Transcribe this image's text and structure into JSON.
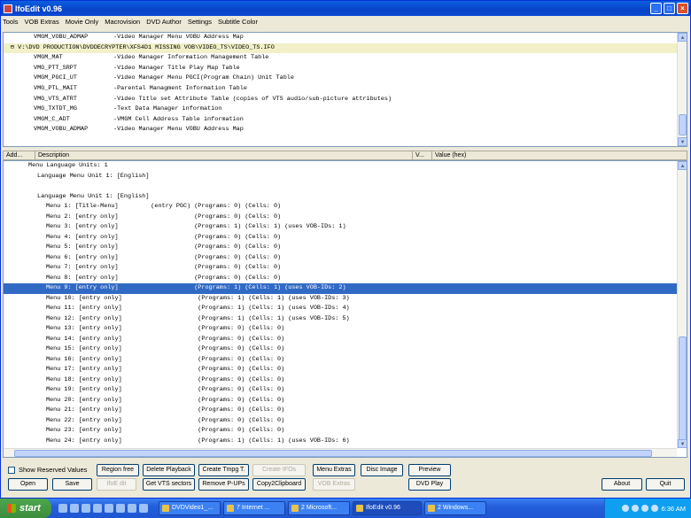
{
  "window": {
    "title": "IfoEdit v0.96",
    "min": "_",
    "max": "□",
    "close": "×"
  },
  "menu": [
    "Tools",
    "VOB Extras",
    "Movie Only",
    "Macrovision",
    "DVD Author",
    "Settings",
    "Subtitle Color"
  ],
  "tree_rows": [
    {
      "name": "VMGM_VOBU_ADMAP",
      "desc": "-Video Manager Menu VOBU Address Map",
      "indent": 1
    },
    {
      "name": "V:\\DVD PRODUCTION\\DVDDECRYPTER\\XFS4D1 MISSING VOB\\VIDEO_TS\\VIDEO_TS.IFO",
      "desc": "",
      "indent": 0,
      "root": true
    },
    {
      "name": "VMGM_MAT",
      "desc": "-Video Manager Information Management Table",
      "indent": 1
    },
    {
      "name": "VMG_PTT_SRPT",
      "desc": "-Video Manager Title Play Map Table",
      "indent": 1
    },
    {
      "name": "VMGM_PGCI_UT",
      "desc": "-Video Manager Menu PGCI(Program Chain) Unit Table",
      "indent": 1
    },
    {
      "name": "VMG_PTL_MAIT",
      "desc": "-Parental Managment Information Table",
      "indent": 1
    },
    {
      "name": "VMG_VTS_ATRT",
      "desc": "-Video Title set Attribute Table (copies of VTS audio/sub-picture attributes)",
      "indent": 1
    },
    {
      "name": "VMG_TXTDT_MG",
      "desc": "-Text Data Manager information",
      "indent": 1
    },
    {
      "name": "VMGM_C_ADT",
      "desc": "-VMGM Cell Address Table information",
      "indent": 1
    },
    {
      "name": "VMGM_VOBU_ADMAP",
      "desc": "-Video Manager Menu VOBU Address Map",
      "indent": 1
    }
  ],
  "list_headers": {
    "add": "Add...",
    "desc": "Description",
    "v": "V...",
    "value": "Value (hex)"
  },
  "list_rows": [
    {
      "text": "Menu Language Units: 1",
      "indent": 4
    },
    {
      "text": "Language Menu Unit 1: [English]",
      "indent": 6
    },
    {
      "text": "",
      "indent": 0
    },
    {
      "text": "Language Menu Unit 1: [English]",
      "indent": 6
    },
    {
      "text": "Menu 1: [Title-Menu]         (entry PGC) (Programs: 0) (Cells: 0)",
      "indent": 8
    },
    {
      "text": "Menu 2: [entry only]                     (Programs: 0) (Cells: 0)",
      "indent": 8
    },
    {
      "text": "Menu 3: [entry only]                     (Programs: 1) (Cells: 1) (uses VOB-IDs: 1)",
      "indent": 8
    },
    {
      "text": "Menu 4: [entry only]                     (Programs: 0) (Cells: 0)",
      "indent": 8
    },
    {
      "text": "Menu 5: [entry only]                     (Programs: 0) (Cells: 0)",
      "indent": 8
    },
    {
      "text": "Menu 6: [entry only]                     (Programs: 0) (Cells: 0)",
      "indent": 8
    },
    {
      "text": "Menu 7: [entry only]                     (Programs: 0) (Cells: 0)",
      "indent": 8
    },
    {
      "text": "Menu 8: [entry only]                     (Programs: 0) (Cells: 0)",
      "indent": 8
    },
    {
      "text": "Menu 9: [entry only]                     (Programs: 1) (Cells: 1) (uses VOB-IDs: 2)",
      "indent": 8,
      "selected": true
    },
    {
      "text": "Menu 10: [entry only]                     (Programs: 1) (Cells: 1) (uses VOB-IDs: 3)",
      "indent": 8
    },
    {
      "text": "Menu 11: [entry only]                     (Programs: 1) (Cells: 1) (uses VOB-IDs: 4)",
      "indent": 8
    },
    {
      "text": "Menu 12: [entry only]                     (Programs: 1) (Cells: 1) (uses VOB-IDs: 5)",
      "indent": 8
    },
    {
      "text": "Menu 13: [entry only]                     (Programs: 0) (Cells: 0)",
      "indent": 8
    },
    {
      "text": "Menu 14: [entry only]                     (Programs: 0) (Cells: 0)",
      "indent": 8
    },
    {
      "text": "Menu 15: [entry only]                     (Programs: 0) (Cells: 0)",
      "indent": 8
    },
    {
      "text": "Menu 16: [entry only]                     (Programs: 0) (Cells: 0)",
      "indent": 8
    },
    {
      "text": "Menu 17: [entry only]                     (Programs: 0) (Cells: 0)",
      "indent": 8
    },
    {
      "text": "Menu 18: [entry only]                     (Programs: 0) (Cells: 0)",
      "indent": 8
    },
    {
      "text": "Menu 19: [entry only]                     (Programs: 0) (Cells: 0)",
      "indent": 8
    },
    {
      "text": "Menu 20: [entry only]                     (Programs: 0) (Cells: 0)",
      "indent": 8
    },
    {
      "text": "Menu 21: [entry only]                     (Programs: 0) (Cells: 0)",
      "indent": 8
    },
    {
      "text": "Menu 22: [entry only]                     (Programs: 0) (Cells: 0)",
      "indent": 8
    },
    {
      "text": "Menu 23: [entry only]                     (Programs: 0) (Cells: 0)",
      "indent": 8
    },
    {
      "text": "Menu 24: [entry only]                     (Programs: 1) (Cells: 1) (uses VOB-IDs: 6)",
      "indent": 8
    }
  ],
  "show_reserved": "Show Reserved Values",
  "buttons": {
    "open": "Open",
    "save": "Save",
    "ifo_it": "IfoE dit",
    "region_free": "Region free",
    "get_vts": "Get VTS sectors",
    "delete_playback": "Delete Playback",
    "remove_pups": "Remove P-UPs",
    "create_tmpg": "Create Tmpg T.",
    "copy2clip": "Copy2Clipboard",
    "create_ifos": "Create IFOs",
    "menu_extras": "Menu Extras",
    "vob_extras": "VOB Extras",
    "disc_image": "Disc Image",
    "preview": "Preview",
    "dvd_play": "DVD Play",
    "about": "About",
    "quit": "Quit"
  },
  "taskbar": {
    "start": "start",
    "tasks": [
      {
        "label": "DVDVideo1_...",
        "active": false
      },
      {
        "label": "7 Internet ...",
        "active": false
      },
      {
        "label": "2 Microsoft...",
        "active": false
      },
      {
        "label": "IfoEdit v0.96",
        "active": true
      },
      {
        "label": "2 Windows...",
        "active": false
      }
    ],
    "clock": "6:36 AM"
  }
}
